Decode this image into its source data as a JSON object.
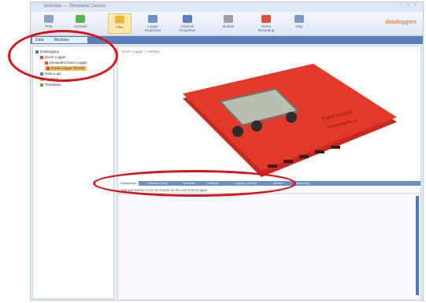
{
  "window": {
    "title": "Simulate — Simulated Device",
    "controls": "– □ ×"
  },
  "ribbon": {
    "buttons": [
      {
        "label": "Print",
        "color": "#8fa3bf"
      },
      {
        "label": "Connect",
        "color": "#57b34a"
      },
      {
        "label": "Files",
        "color": "#e8b941"
      },
      {
        "label": "Logger Properties",
        "color": "#6b8fc6"
      },
      {
        "label": "Channel Properties",
        "color": "#5a7fb7"
      },
      {
        "label": "Module",
        "color": "#9a9ea8"
      },
      {
        "label": "Event Recording",
        "color": "#d9523a"
      },
      {
        "label": "Help",
        "color": "#7f98c2"
      }
    ],
    "brand": "dataloggers"
  },
  "navbar": {
    "tab1": "Data",
    "tab2": "Modules"
  },
  "tree": {
    "nodes": [
      {
        "label": "Datalogging",
        "color": "#4b7bd0"
      },
      {
        "label": "Event Logger",
        "color": "#d9523a"
      },
      {
        "label": "Simulated Event Logger",
        "color": "#d9523a"
      },
      {
        "label": "Event Logger (Serial)",
        "color": "#d9523a"
      },
      {
        "label": "Data Logs",
        "color": "#4b7bd0"
      },
      {
        "label": "Modules",
        "color": "#e8b941"
      },
      {
        "label": "Templates",
        "color": "#57b34a"
      }
    ]
  },
  "main": {
    "preview_label": "Event Logger 1 Settings",
    "tabs": [
      "Information",
      "Channel Setup",
      "Modules",
      "Settings",
      "Logging Options",
      "Alarms",
      "Scheduling"
    ],
    "info_text": "Manual startup to be as simple as the unit Event logger.",
    "device": {
      "body_color": "#e2392a",
      "screen_color": "#b8c0b4",
      "label_line1": "EVENT LOGGER",
      "label_line2": "www.dataloggers.com"
    }
  }
}
